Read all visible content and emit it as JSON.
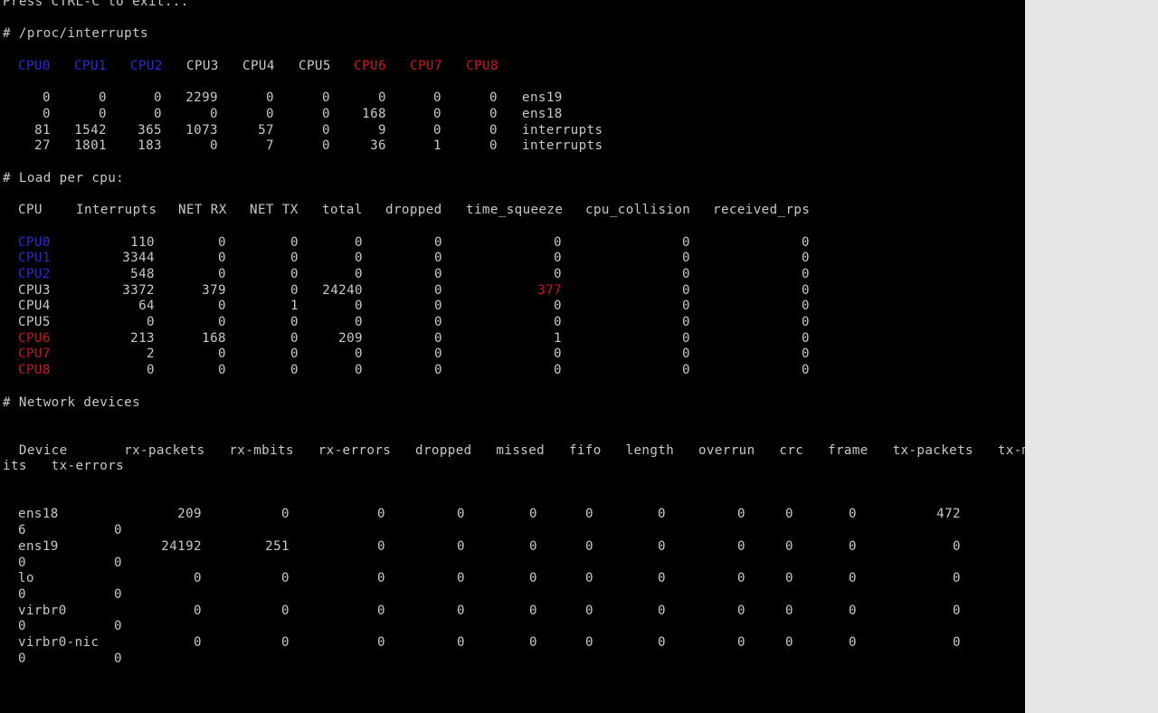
{
  "terminal": {
    "exit_hint": "Press CTRL-C to exit...",
    "interrupts": {
      "title": "# /proc/interrupts",
      "cpu_headers": [
        {
          "label": "CPU0",
          "color": "blue"
        },
        {
          "label": "CPU1",
          "color": "blue"
        },
        {
          "label": "CPU2",
          "color": "blue"
        },
        {
          "label": "CPU3",
          "color": "white"
        },
        {
          "label": "CPU4",
          "color": "white"
        },
        {
          "label": "CPU5",
          "color": "white"
        },
        {
          "label": "CPU6",
          "color": "red"
        },
        {
          "label": "CPU7",
          "color": "red"
        },
        {
          "label": "CPU8",
          "color": "red"
        }
      ],
      "rows": [
        {
          "values": [
            "0",
            "0",
            "0",
            "2299",
            "0",
            "0",
            "0",
            "0",
            "0"
          ],
          "name": "ens19"
        },
        {
          "values": [
            "0",
            "0",
            "0",
            "0",
            "0",
            "0",
            "168",
            "0",
            "0"
          ],
          "name": "ens18"
        },
        {
          "values": [
            "81",
            "1542",
            "365",
            "1073",
            "57",
            "0",
            "9",
            "0",
            "0"
          ],
          "name": "interrupts"
        },
        {
          "values": [
            "27",
            "1801",
            "183",
            "0",
            "7",
            "0",
            "36",
            "1",
            "0"
          ],
          "name": "interrupts"
        }
      ]
    },
    "load": {
      "title": "# Load per cpu:",
      "headers": [
        "CPU",
        "Interrupts",
        "NET RX",
        "NET TX",
        "total",
        "dropped",
        "time_squeeze",
        "cpu_collision",
        "received_rps"
      ],
      "rows": [
        {
          "cpu": "CPU0",
          "color": "blue",
          "values": [
            "110",
            "0",
            "0",
            "0",
            "0",
            "0",
            "0",
            "0"
          ]
        },
        {
          "cpu": "CPU1",
          "color": "blue",
          "values": [
            "3344",
            "0",
            "0",
            "0",
            "0",
            "0",
            "0",
            "0"
          ]
        },
        {
          "cpu": "CPU2",
          "color": "blue",
          "values": [
            "548",
            "0",
            "0",
            "0",
            "0",
            "0",
            "0",
            "0"
          ]
        },
        {
          "cpu": "CPU3",
          "color": "white",
          "values": [
            "3372",
            "379",
            "0",
            "24240",
            "0",
            "377",
            "0",
            "0"
          ],
          "highlight": 5
        },
        {
          "cpu": "CPU4",
          "color": "white",
          "values": [
            "64",
            "0",
            "1",
            "0",
            "0",
            "0",
            "0",
            "0"
          ]
        },
        {
          "cpu": "CPU5",
          "color": "white",
          "values": [
            "0",
            "0",
            "0",
            "0",
            "0",
            "0",
            "0",
            "0"
          ]
        },
        {
          "cpu": "CPU6",
          "color": "red",
          "values": [
            "213",
            "168",
            "0",
            "209",
            "0",
            "1",
            "0",
            "0"
          ]
        },
        {
          "cpu": "CPU7",
          "color": "red",
          "values": [
            "2",
            "0",
            "0",
            "0",
            "0",
            "0",
            "0",
            "0"
          ]
        },
        {
          "cpu": "CPU8",
          "color": "red",
          "values": [
            "0",
            "0",
            "0",
            "0",
            "0",
            "0",
            "0",
            "0"
          ]
        }
      ]
    },
    "network": {
      "title": "# Network devices",
      "header_line1": "  Device       rx-packets   rx-mbits   rx-errors   dropped   missed   fifo   length   overrun   crc   frame   tx-packets   tx-mb",
      "header_line2": "its   tx-errors",
      "devices": [
        {
          "name": "ens18",
          "values": [
            "209",
            "0",
            "0",
            "0",
            "0",
            "0",
            "0",
            "0",
            "0",
            "0",
            "472"
          ],
          "wrap": [
            "6",
            "0"
          ]
        },
        {
          "name": "ens19",
          "values": [
            "24192",
            "251",
            "0",
            "0",
            "0",
            "0",
            "0",
            "0",
            "0",
            "0",
            "0"
          ],
          "wrap": [
            "0",
            "0"
          ]
        },
        {
          "name": "lo",
          "values": [
            "0",
            "0",
            "0",
            "0",
            "0",
            "0",
            "0",
            "0",
            "0",
            "0",
            "0"
          ],
          "wrap": [
            "0",
            "0"
          ]
        },
        {
          "name": "virbr0",
          "values": [
            "0",
            "0",
            "0",
            "0",
            "0",
            "0",
            "0",
            "0",
            "0",
            "0",
            "0"
          ],
          "wrap": [
            "0",
            "0"
          ]
        },
        {
          "name": "virbr0-nic",
          "values": [
            "0",
            "0",
            "0",
            "0",
            "0",
            "0",
            "0",
            "0",
            "0",
            "0",
            "0"
          ],
          "wrap": [
            "0",
            "0"
          ]
        }
      ]
    }
  },
  "colors": {
    "background": "#000000",
    "text": "#c8c8c8",
    "blue": "#2a2ad8",
    "red": "#c81818",
    "margin": "#e6e6e6"
  }
}
